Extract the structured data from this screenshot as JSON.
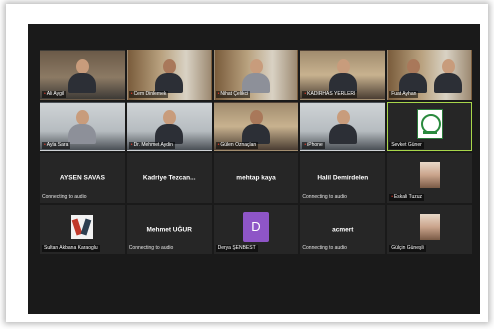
{
  "meeting": {
    "participants": [
      {
        "name": "Ali Aygil",
        "kind": "video",
        "bg": "video-room",
        "mic_muted": true
      },
      {
        "name": "Cem Dinlemek",
        "kind": "video",
        "bg": "video-shelf",
        "mic_muted": true
      },
      {
        "name": "Nihat Çelikci",
        "kind": "video",
        "bg": "video-shelf",
        "mic_muted": true
      },
      {
        "name": "KADIRHAS YERLERI",
        "kind": "video",
        "bg": "video-warm",
        "mic_muted": true
      },
      {
        "name": "",
        "kind": "video",
        "bg": "video-dark",
        "mic_muted": false
      },
      {
        "name": "Fuat Ayhan",
        "kind": "video",
        "bg": "video-shelf",
        "mic_muted": false
      },
      {
        "name": "Ayla Sara",
        "kind": "video",
        "bg": "video-light",
        "mic_muted": true
      },
      {
        "name": "Dr. Mehmet Aydin",
        "kind": "video",
        "bg": "video-light",
        "mic_muted": true
      },
      {
        "name": "Gülen Öznaçlan",
        "kind": "video",
        "bg": "video-warm",
        "mic_muted": true
      },
      {
        "name": "iPhone",
        "kind": "video",
        "bg": "video-light",
        "mic_muted": true
      },
      {
        "name": "Sevket Güner",
        "kind": "logo",
        "mic_muted": false,
        "active": true
      },
      {
        "name": "AYSEN SAVAS",
        "kind": "name",
        "status": "Connecting to audio"
      },
      {
        "name": "Kadriye Tezcan...",
        "kind": "name",
        "status": ""
      },
      {
        "name": "mehtap kaya",
        "kind": "name",
        "status": ""
      },
      {
        "name": "Halil Demirdelen",
        "kind": "name",
        "status": "Connecting to audio"
      },
      {
        "name": "Eskali Tuzuz",
        "kind": "photo",
        "mic_muted": true
      },
      {
        "name": "Sultan Akbana Karaoglu",
        "kind": "art",
        "mic_muted": false
      },
      {
        "name": "Mehmet UĞUR",
        "kind": "name",
        "status": "Connecting to audio"
      },
      {
        "name": "Derya ŞENBEST",
        "kind": "avatar",
        "letter": "D",
        "mic_muted": false
      },
      {
        "name": "acmert",
        "kind": "name",
        "status": "Connecting to audio"
      },
      {
        "name": "Gülçin Güneşli",
        "kind": "photo",
        "mic_muted": false
      }
    ]
  }
}
